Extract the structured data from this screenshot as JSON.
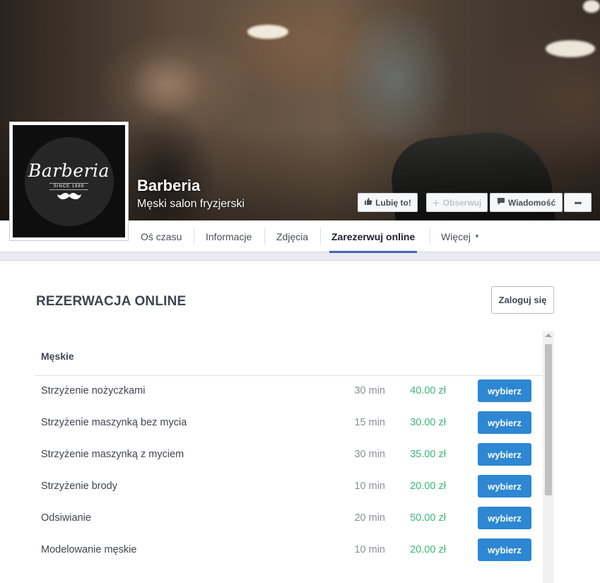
{
  "page": {
    "name": "Barberia",
    "category": "Męski salon fryzjerski"
  },
  "logo": {
    "wordmark": "Barberia",
    "since": "SINCE 1989"
  },
  "actions": {
    "like": "Lubię to!",
    "follow": "Obserwuj",
    "message": "Wiadomość",
    "more": "•••"
  },
  "tabs": [
    {
      "label": "Oś czasu"
    },
    {
      "label": "Informacje"
    },
    {
      "label": "Zdjęcia"
    },
    {
      "label": "Zarezerwuj online",
      "active": true
    },
    {
      "label": "Więcej",
      "has_caret": true
    }
  ],
  "reservation": {
    "title": "REZERWACJA ONLINE",
    "login": "Zaloguj się",
    "category": "Męskie",
    "select_label": "wybierz",
    "services": [
      {
        "name": "Strzyżenie nożyczkami",
        "duration": "30 min",
        "price": "40.00 zł"
      },
      {
        "name": "Strzyżenie maszynką bez mycia",
        "duration": "15 min",
        "price": "30.00 zł"
      },
      {
        "name": "Strzyżenie maszynką z myciem",
        "duration": "30 min",
        "price": "35.00 zł"
      },
      {
        "name": "Strzyżenie brody",
        "duration": "10 min",
        "price": "20.00 zł"
      },
      {
        "name": "Odsiwianie",
        "duration": "20 min",
        "price": "50.00 zł"
      },
      {
        "name": "Modelowanie męskie",
        "duration": "10 min",
        "price": "20.00 zł"
      }
    ]
  },
  "colors": {
    "accent_button": "#2d87d3",
    "price_green": "#3cb874",
    "tab_active": "#4267b2"
  },
  "icons": {
    "like": "thumbs-up-icon",
    "follow": "plus-icon",
    "message": "speech-bubble-icon"
  }
}
